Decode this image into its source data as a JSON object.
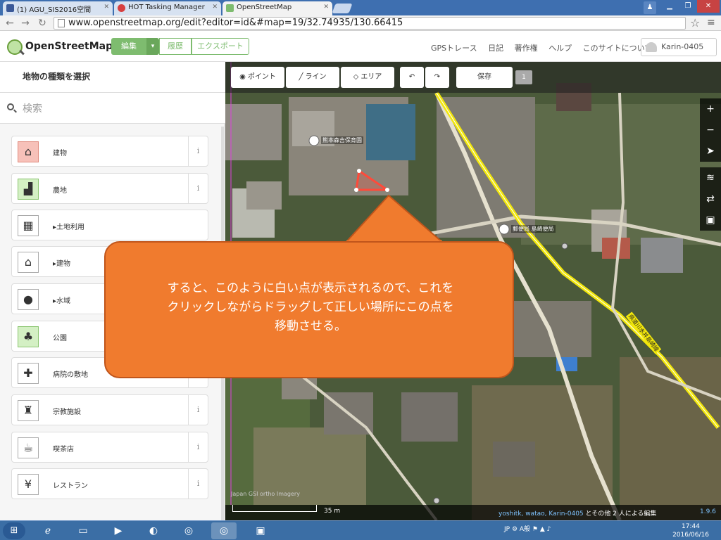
{
  "browser": {
    "tabs": [
      {
        "title": "(1) AGU_SIS2016空間",
        "favicon_color": "#3b5998"
      },
      {
        "title": "HOT Tasking Manager",
        "favicon_color": "#d73f3f"
      },
      {
        "title": "OpenStreetMap",
        "favicon_color": "#7ebc6f"
      }
    ],
    "url": "www.openstreetmap.org/edit?editor=id&#map=19/32.74935/130.66415"
  },
  "osm_header": {
    "logo_text": "OpenStreetMap",
    "edit_button": "編集",
    "history_button": "履歴",
    "export_button": "エクスポート",
    "nav_links": [
      "GPSトレース",
      "日記",
      "著作権",
      "ヘルプ",
      "このサイトについて"
    ],
    "user": "Karin-0405"
  },
  "sidebar": {
    "header": "地物の種類を選択",
    "search_placeholder": "検索",
    "presets": [
      {
        "label": "建物",
        "icon": "building-icon",
        "glyph": "⌂",
        "style": "red",
        "info": "i"
      },
      {
        "label": "農地",
        "icon": "farm-icon",
        "glyph": "▟",
        "style": "green",
        "info": "i"
      },
      {
        "label": "▸土地利用",
        "icon": "landuse-icon",
        "glyph": "▦",
        "style": "plain",
        "info": ""
      },
      {
        "label": "▸建物",
        "icon": "building-category-icon",
        "glyph": "⌂",
        "style": "plain",
        "info": ""
      },
      {
        "label": "▸水域",
        "icon": "water-icon",
        "glyph": "●",
        "style": "plain",
        "info": ""
      },
      {
        "label": "公園",
        "icon": "park-tree-icon",
        "glyph": "♣",
        "style": "green",
        "info": "i"
      },
      {
        "label": "病院の敷地",
        "icon": "hospital-icon",
        "glyph": "✚",
        "style": "plain",
        "info": "i"
      },
      {
        "label": "宗教施設",
        "icon": "place-of-worship-icon",
        "glyph": "♜",
        "style": "plain",
        "info": "i"
      },
      {
        "label": "喫茶店",
        "icon": "cafe-icon",
        "glyph": "☕",
        "style": "plain",
        "info": "i"
      },
      {
        "label": "レストラン",
        "icon": "restaurant-icon",
        "glyph": "¥",
        "style": "plain",
        "info": "i"
      }
    ]
  },
  "map": {
    "tools": {
      "point": "ポイント",
      "line": "ライン",
      "area": "エリア",
      "save": "保存"
    },
    "edit_count": "1",
    "poi_labels": [
      "熊本森吉保育園",
      "郵便局 島崎便局"
    ],
    "road_label": "県道川水井島崎線",
    "scale_text": "35 m",
    "imagery_attribution": "Japan GSI ortho Imagery",
    "contributors": {
      "users": "yoshitk, watao, Karin-0405",
      "suffix": " とその他 2 人による編集"
    },
    "version": "1.9.6",
    "controls": [
      "+",
      "−",
      "➤",
      "≋",
      "⇄",
      "▣"
    ]
  },
  "callout": {
    "line1": "すると、このように白い点が表示されるので、これを",
    "line2": "クリックしながらドラッグして正しい場所にこの点を",
    "line3": "移動させる。",
    "color": "#f07b2e"
  },
  "taskbar": {
    "lang": "JP",
    "time": "17:44",
    "date": "2016/06/16"
  }
}
